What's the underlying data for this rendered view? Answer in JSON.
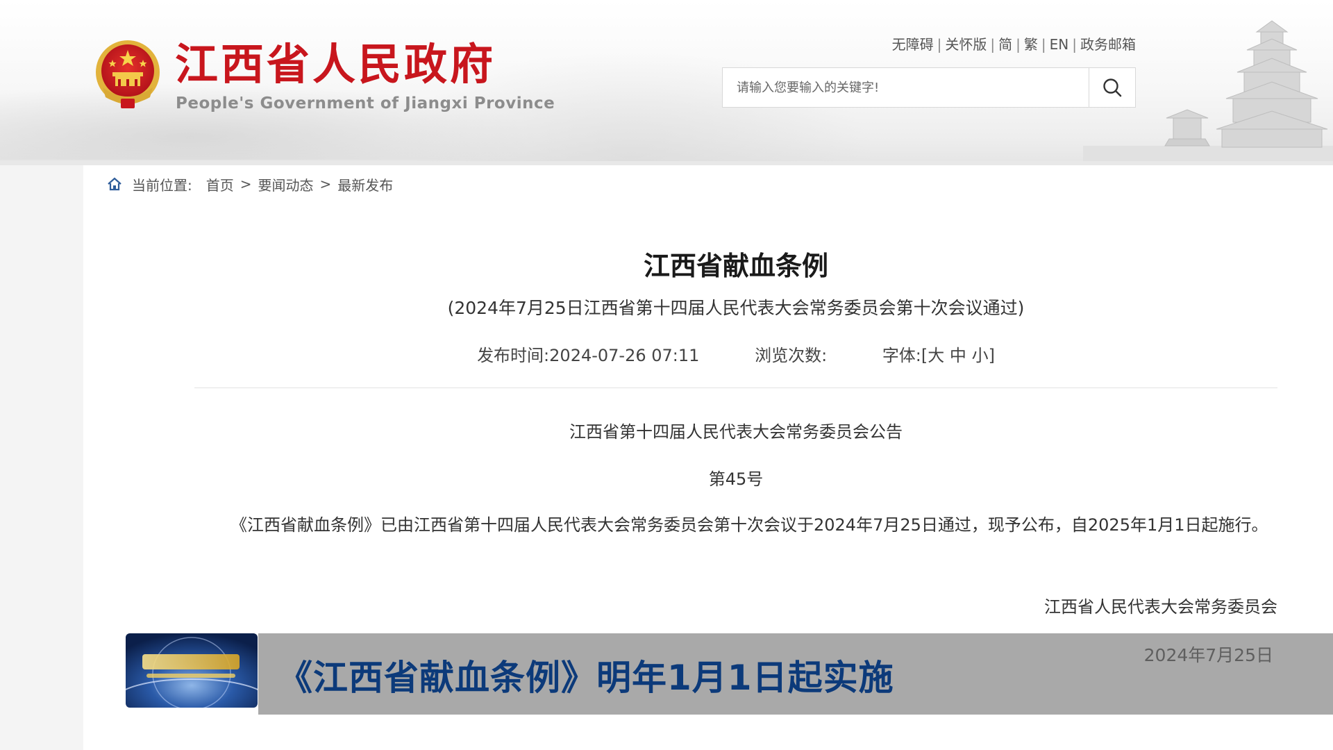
{
  "header": {
    "site_title": "江西省人民政府",
    "site_subtitle": "People's Government of Jiangxi Province",
    "top_links": [
      {
        "id": "accessibility",
        "label": "无障碍"
      },
      {
        "id": "elder-mode",
        "label": "关怀版"
      },
      {
        "id": "simplified",
        "label": "简"
      },
      {
        "id": "traditional",
        "label": "繁"
      },
      {
        "id": "english",
        "label": "EN"
      },
      {
        "id": "gov-mail",
        "label": "政务邮箱"
      }
    ],
    "search": {
      "placeholder": "请输入您要输入的关键字!",
      "value": ""
    }
  },
  "breadcrumb": {
    "label": "当前位置:",
    "items": [
      "首页",
      "要闻动态",
      "最新发布"
    ]
  },
  "article": {
    "title": "江西省献血条例",
    "subtitle": "(2024年7月25日江西省第十四届人民代表大会常务委员会第十次会议通过)",
    "meta": {
      "publish_label": "发布时间:",
      "publish_time": "2024-07-26 07:11",
      "views_label": "浏览次数:",
      "views_value": "",
      "font_label": "字体:",
      "font_open": "[",
      "font_large": "大",
      "font_medium": "中",
      "font_small": "小",
      "font_close": "]"
    },
    "notice_title": "江西省第十四届人民代表大会常务委员会公告",
    "notice_number": "第45号",
    "body": "《江西省献血条例》已由江西省第十四届人民代表大会常务委员会第十次会议于2024年7月25日通过，现予公布，自2025年1月1日起施行。",
    "signature": "江西省人民代表大会常务委员会"
  },
  "banner": {
    "headline": "《江西省献血条例》明年1月1日起实施",
    "date": "2024年7月25日"
  },
  "colors": {
    "brand_red": "#c8161d",
    "headline_blue": "#0c3a7a",
    "banner_gray": "#a9a9a9"
  },
  "icons": {
    "search": "search-icon",
    "home": "home-icon",
    "emblem": "national-emblem-icon",
    "pagoda": "pagoda-illustration",
    "news_logo": "news-program-logo"
  }
}
